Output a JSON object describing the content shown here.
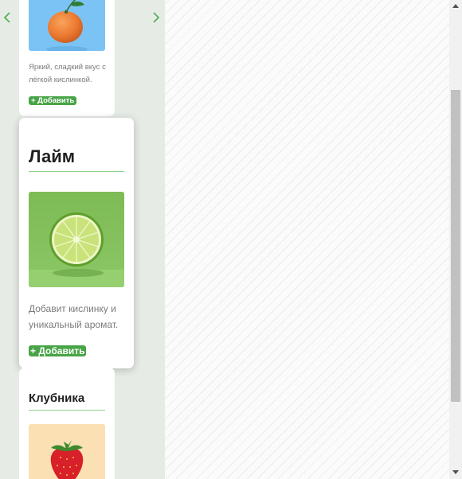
{
  "navigation": {
    "prev_icon": "chevron-left-icon",
    "next_icon": "chevron-right-icon",
    "accent_color": "#47a447"
  },
  "cards": [
    {
      "name": "",
      "description": "Яркий, сладкий вкус с лёгкой кислинкой.",
      "add_label": "+ Добавить",
      "image": "mandarin-photo"
    },
    {
      "name": "Лайм",
      "description": "Добавит кислинку и уникальный аромат.",
      "add_label": "+ Добавить",
      "image": "lime-photo"
    },
    {
      "name": "Клубника",
      "image": "strawberry-photo"
    }
  ],
  "colors": {
    "background": "#e6ebe5",
    "card": "#ffffff",
    "button": "#47a447",
    "divider": "#8fd08e"
  }
}
